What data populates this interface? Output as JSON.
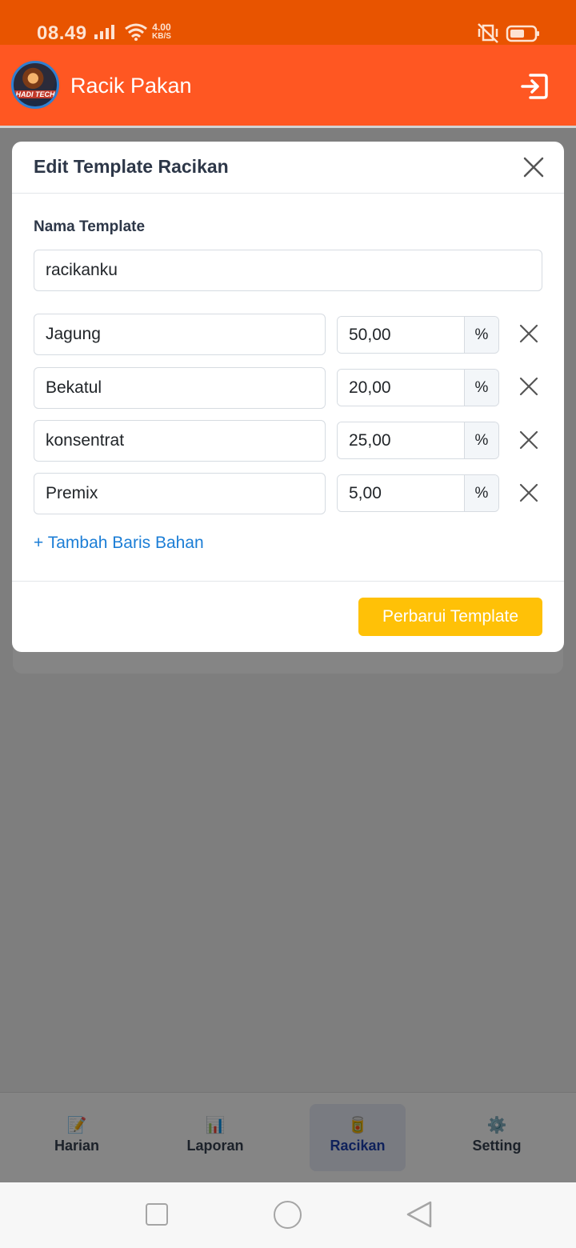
{
  "status_bar": {
    "time": "08.49",
    "net_speed_value": "4.00",
    "net_speed_unit": "KB/S"
  },
  "app_bar": {
    "avatar_text": "HADI TECH",
    "title": "Racik Pakan"
  },
  "modal": {
    "title": "Edit Template Racikan",
    "template_name_label": "Nama Template",
    "template_name_value": "racikanku",
    "rows": [
      {
        "name": "Jagung",
        "percent": "50,00",
        "unit": "%"
      },
      {
        "name": "Bekatul",
        "percent": "20,00",
        "unit": "%"
      },
      {
        "name": "konsentrat",
        "percent": "25,00",
        "unit": "%"
      },
      {
        "name": "Premix",
        "percent": "5,00",
        "unit": "%"
      }
    ],
    "add_row_label": "+ Tambah Baris Bahan",
    "submit_label": "Perbarui Template"
  },
  "bottom_nav": {
    "items": [
      {
        "label": "Harian",
        "icon": "📝"
      },
      {
        "label": "Laporan",
        "icon": "📊"
      },
      {
        "label": "Racikan",
        "icon": "🥫",
        "active": true
      },
      {
        "label": "Setting",
        "icon": "⚙️"
      }
    ]
  },
  "colors": {
    "status_bar": "#e85400",
    "app_bar": "#ff5722",
    "primary_button": "#ffc107",
    "link": "#1c7ed6",
    "active_nav": "#1e40af"
  }
}
